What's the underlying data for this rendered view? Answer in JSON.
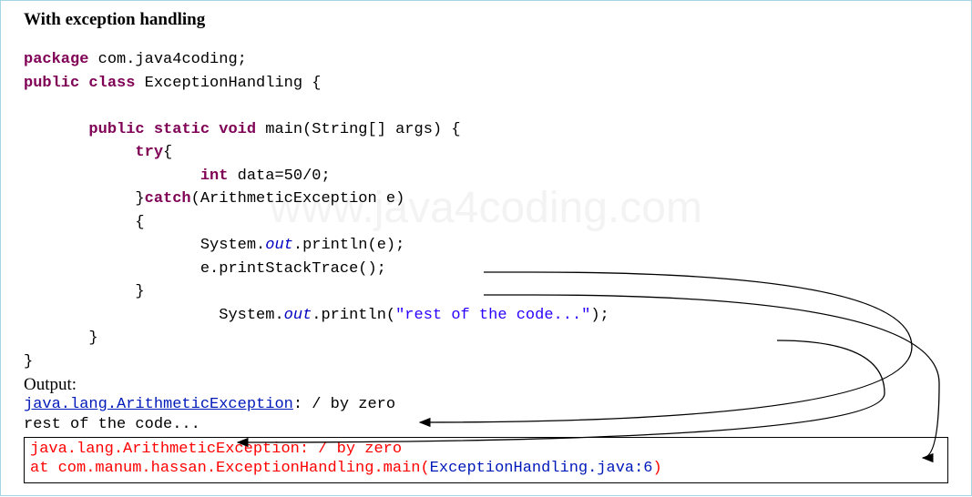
{
  "title": "With exception handling",
  "code": {
    "pkg_kw": "package",
    "pkg_name": " com.java4coding;",
    "public_kw": "public",
    "class_kw": "class",
    "class_name": " ExceptionHandling {",
    "static_kw": "static",
    "void_kw": "void",
    "main_sig": " main(String[] args) {",
    "try_kw": "try",
    "try_open": "{",
    "int_kw": "int",
    "int_line": " data=50/0;",
    "catch_close_try": "}",
    "catch_kw": "catch",
    "catch_sig": "(ArithmeticException e)",
    "open_brace": "{",
    "sys": "System.",
    "out_it": "out",
    "println_e": ".println(e);",
    "trace": "e.printStackTrace();",
    "close_brace": "}",
    "println_rest1": ".println(",
    "rest_str": "\"rest of the code...\"",
    "println_rest2": ");",
    "close_main": "}",
    "close_class": "}"
  },
  "output": {
    "label": "Output:",
    "line1_link": "java.lang.ArithmeticException",
    "line1_rest": ": / by zero",
    "line2": "rest of the code...",
    "stack1": "java.lang.ArithmeticException: / by zero",
    "stack2_a": "       at com.manum.hassan.ExceptionHandling.main(",
    "stack2_b": "ExceptionHandling.java:6",
    "stack2_c": ")"
  },
  "watermark": "www.java4coding.com"
}
